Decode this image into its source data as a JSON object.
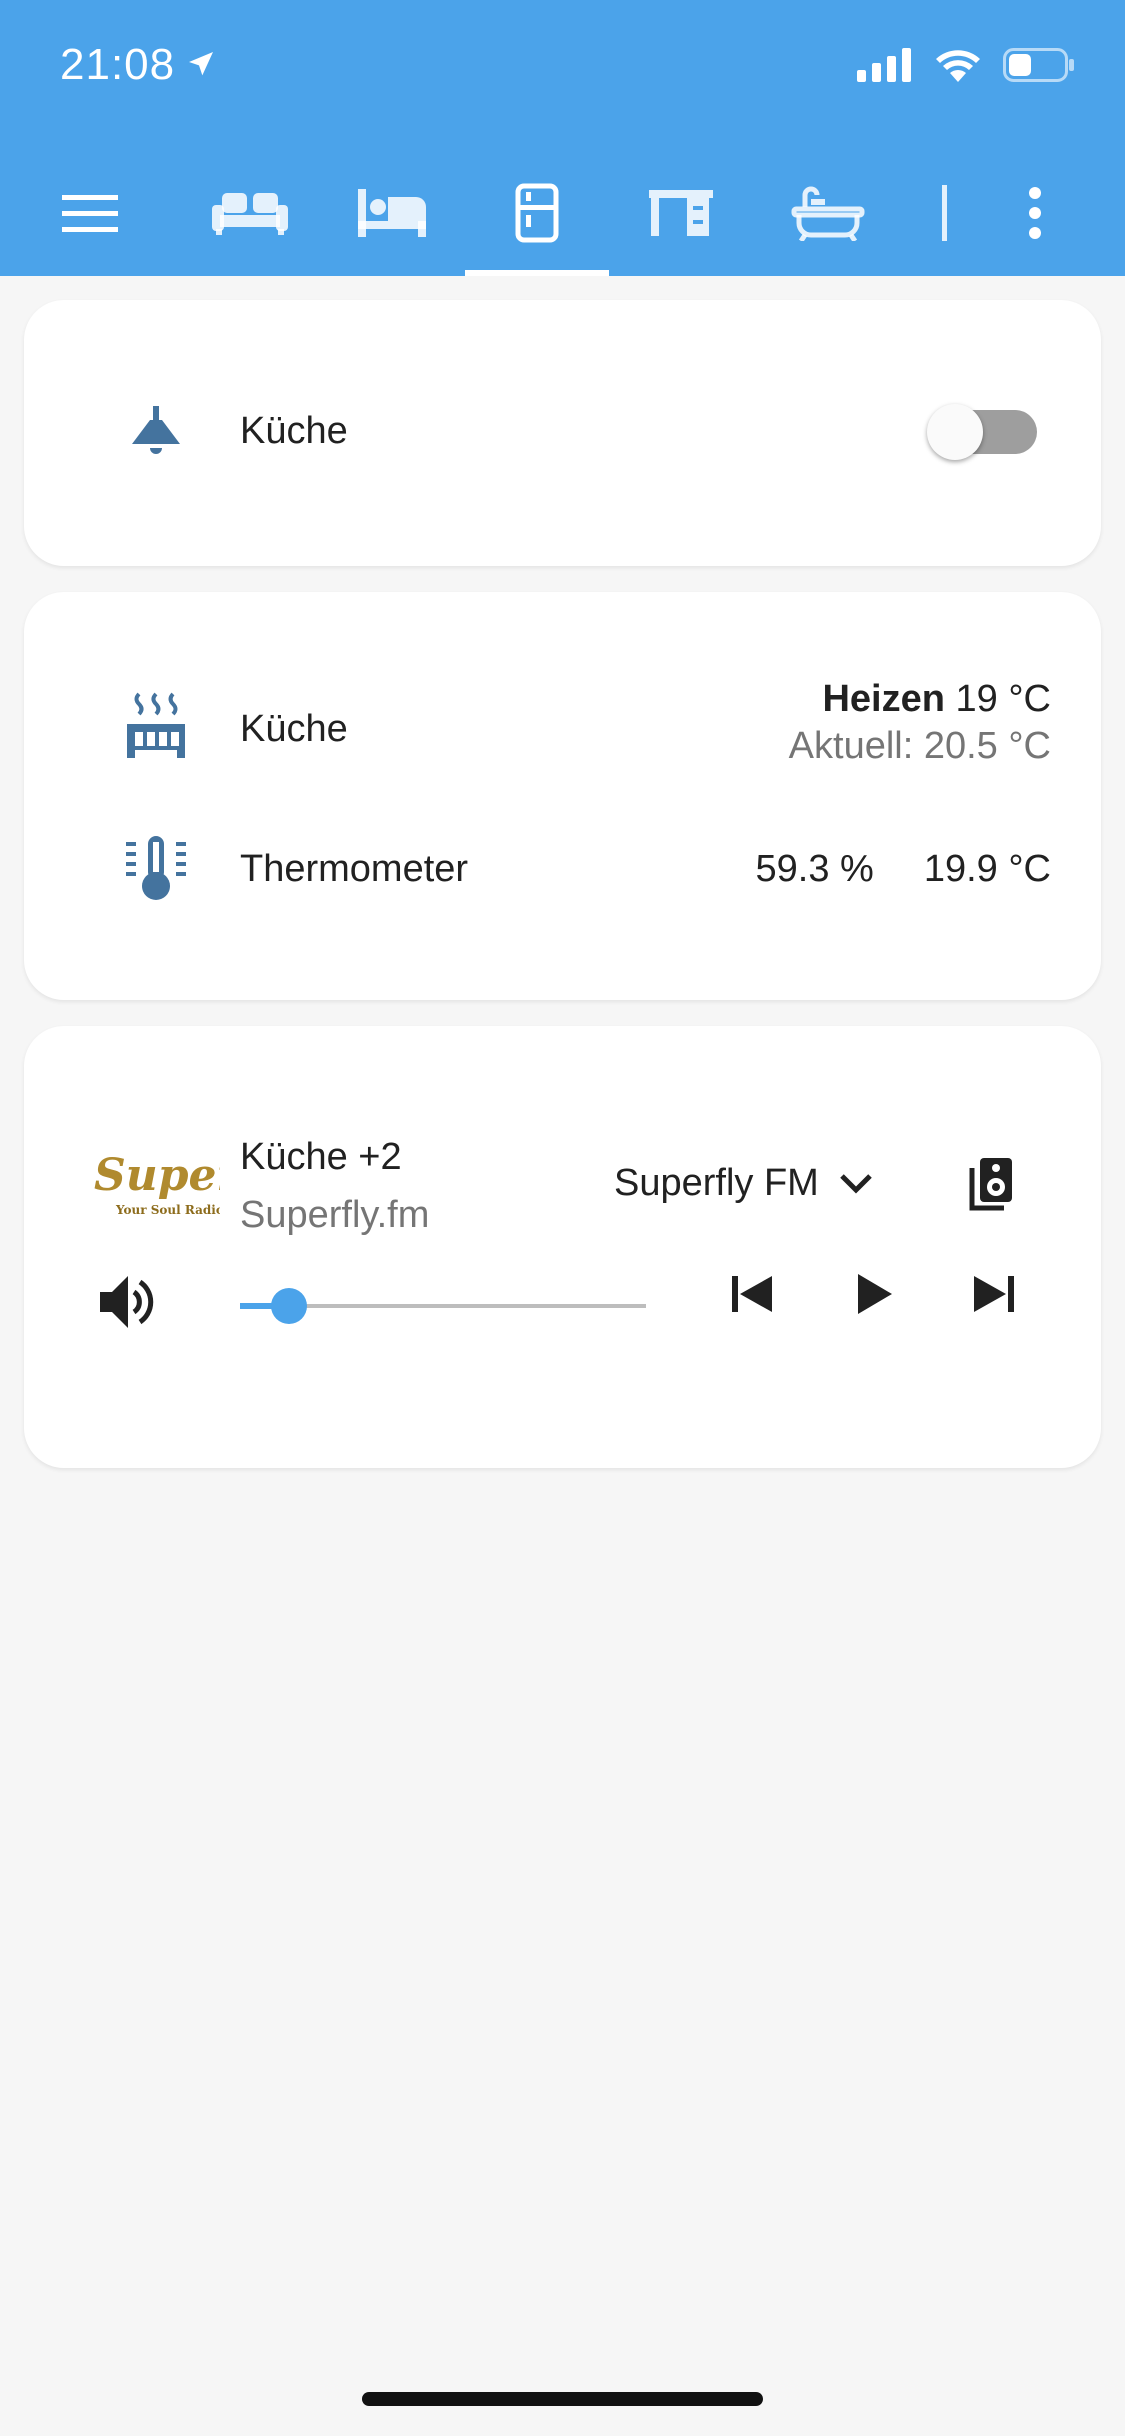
{
  "status_bar": {
    "time": "21:08"
  },
  "toolbar": {
    "tabs": [
      "sofa",
      "bed",
      "fridge",
      "desk",
      "bathtub"
    ],
    "active_tab": "fridge"
  },
  "light_card": {
    "name": "Küche",
    "state": "off"
  },
  "climate_card": {
    "heater": {
      "name": "Küche",
      "mode": "Heizen",
      "target": "19 °C",
      "current": "Aktuell: 20.5 °C"
    },
    "thermometer": {
      "name": "Thermometer",
      "humidity": "59.3 %",
      "temperature": "19.9 °C"
    }
  },
  "media_card": {
    "logo_text": "Superfly",
    "logo_tagline": "Your Soul Radio",
    "title": "Küche +2",
    "subtitle": "Superfly.fm",
    "source": "Superfly FM",
    "volume_fraction": 0.12
  },
  "colors": {
    "header": "#4ba3ea",
    "icon": "#44739e",
    "accent": "#4ba3ea",
    "background": "#f6f6f6"
  }
}
